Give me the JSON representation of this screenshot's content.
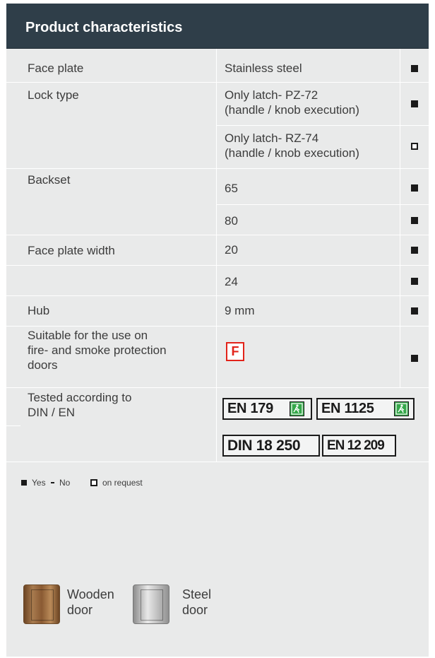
{
  "title": "Product characteristics",
  "rows": [
    {
      "label": "Face plate",
      "value": "Stainless steel",
      "mark": "yes"
    },
    {
      "label": "Lock type",
      "value_lines": [
        "Only latch- PZ-72",
        "(handle / knob execution)"
      ],
      "mark": "yes"
    },
    {
      "label": "",
      "value_lines": [
        "Only latch- RZ-74",
        "(handle / knob execution)"
      ],
      "mark": "on_request"
    },
    {
      "label": "Backset",
      "value": "65",
      "mark": "yes"
    },
    {
      "label": "",
      "value": "80",
      "mark": "yes"
    },
    {
      "label": "Face plate width",
      "value": "20",
      "mark": "yes"
    },
    {
      "label": "",
      "value": "24",
      "mark": "yes"
    },
    {
      "label": "Hub",
      "value": "9 mm",
      "mark": "yes"
    },
    {
      "label_lines": [
        "Suitable for the use on",
        "fire- and smoke protection",
        "doors"
      ],
      "badge": "F",
      "mark": "yes"
    },
    {
      "label_lines": [
        "Tested according to",
        "DIN / EN"
      ],
      "certificates": [
        "EN 179",
        "EN 1125",
        "DIN 18 250",
        "EN 12 209"
      ]
    }
  ],
  "legend": {
    "yes": "Yes",
    "no": "No",
    "on_request": "on request"
  },
  "doors": [
    {
      "label_lines": [
        "Wooden",
        "door"
      ],
      "icon": "wooden-door-icon"
    },
    {
      "label_lines": [
        "Steel",
        "door"
      ],
      "icon": "steel-door-icon"
    }
  ],
  "colors": {
    "header": "#2f3e49",
    "panel": "#e9eaea",
    "fire_badge": "#e2231a",
    "exit_sign": "#35a84a"
  }
}
